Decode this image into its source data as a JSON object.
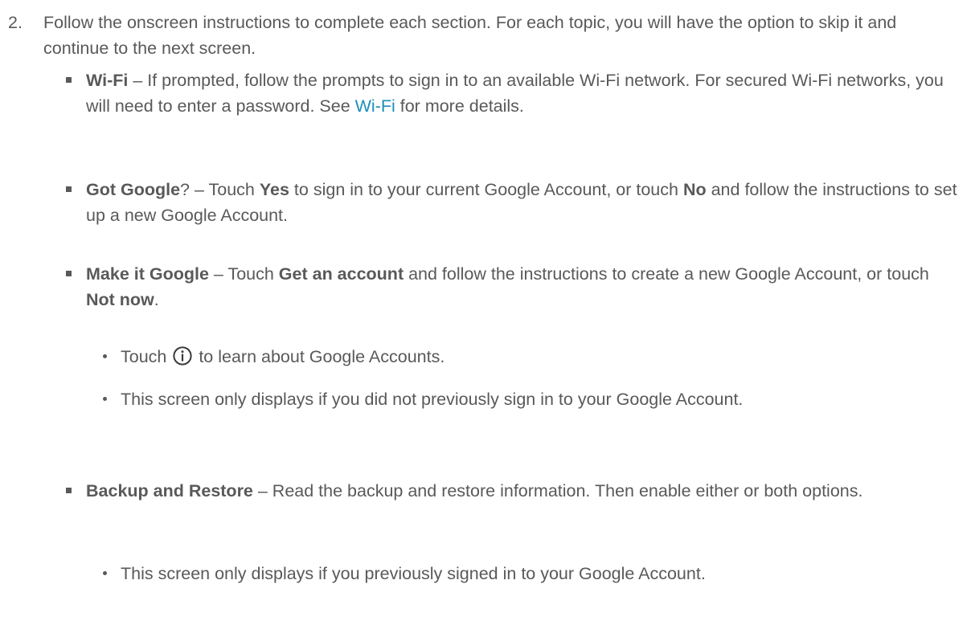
{
  "step": {
    "number": "2.",
    "text": "Follow the onscreen instructions to complete each section. For each topic, you will have the option to skip it and continue to the next screen."
  },
  "wifi": {
    "title": "Wi-Fi",
    "text1": " – If prompted, follow the prompts to sign in to an available Wi-Fi network. For secured Wi-Fi networks, you will need to enter a password. See ",
    "link": "Wi-Fi",
    "text2": " for more details."
  },
  "got_google": {
    "title": "Got Google",
    "text1": "? – Touch ",
    "yes": "Yes",
    "text2": " to sign in to your current Google Account, or touch ",
    "no": "No",
    "text3": " and follow the instructions to set up a new Google Account."
  },
  "make_google": {
    "title": "Make it Google",
    "text1": " – Touch ",
    "get_account": "Get an account",
    "text2": " and follow the instructions to create a new Google Account, or touch ",
    "not_now": "Not now",
    "text3": ".",
    "sub1_a": "Touch ",
    "sub1_icon": "info-icon",
    "sub1_b": " to learn about Google Accounts.",
    "sub2": "This screen only displays if you did not previously sign in to your Google Account."
  },
  "backup": {
    "title": "Backup and Restore",
    "text1": " – Read the backup and restore information. Then enable either or both options.",
    "sub1": "This screen only displays if you previously signed in to your Google Account."
  },
  "colors": {
    "text": "#595959",
    "link": "#1a8fb8"
  }
}
